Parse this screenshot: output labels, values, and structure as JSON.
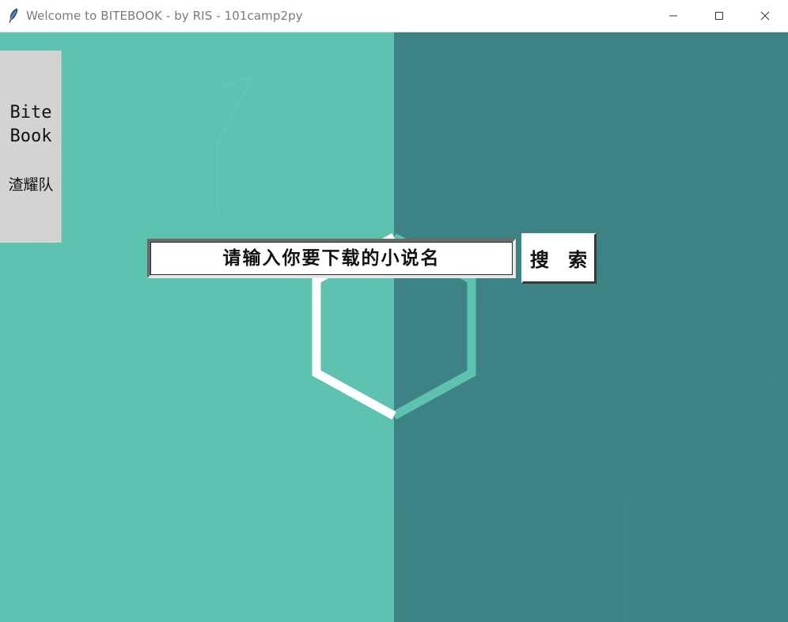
{
  "window": {
    "title": "Welcome to BITEBOOK - by RIS - 101camp2py",
    "app_icon": "feather-icon",
    "controls": {
      "minimize_icon": "minimize-icon",
      "maximize_icon": "maximize-icon",
      "close_icon": "close-icon"
    }
  },
  "sidebar": {
    "app_name_line1": "Bite",
    "app_name_line2": "Book",
    "team_name": "渣耀队"
  },
  "search": {
    "placeholder": "请输入你要下载的小说名",
    "button_label": "搜 索"
  },
  "colors": {
    "background_left": "#5ec2b0",
    "background_right": "#3d8284",
    "sidebar_bg": "#d3d3d3",
    "hexagon_stroke": "#ffffff"
  },
  "decor": {
    "hexagon_icon": "hexagon-logo-icon"
  }
}
